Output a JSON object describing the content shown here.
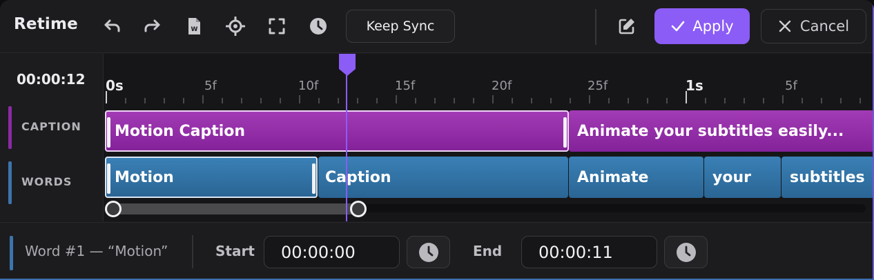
{
  "toolbar": {
    "title": "Retime",
    "icons": [
      "undo-icon",
      "redo-icon",
      "word-file-icon",
      "crosshair-icon",
      "fullscreen-icon",
      "clock-icon",
      "edit-icon"
    ],
    "keep_sync_label": "Keep Sync",
    "apply_label": "Apply",
    "cancel_label": "Cancel"
  },
  "timeline": {
    "current_time": "00:00:12",
    "ruler_labels": [
      "0s",
      "5f",
      "10f",
      "15f",
      "20f",
      "25f",
      "1s",
      "5f"
    ],
    "tracks": [
      {
        "label": "CAPTION",
        "color": "#8b2aa3",
        "clips": [
          "Motion Caption",
          "Animate your subtitles easily..."
        ]
      },
      {
        "label": "WORDS",
        "color": "#3c74ad",
        "clips": [
          "Motion",
          "Caption",
          "Animate",
          "your",
          "subtitles"
        ]
      }
    ],
    "playhead_color": "#8b5cf6"
  },
  "footer": {
    "selection": "Word #1 — “Motion”",
    "start_label": "Start",
    "start_value": "00:00:00",
    "end_label": "End",
    "end_value": "00:00:11"
  },
  "colors": {
    "accent": "#8b5cf6",
    "caption_clip": "#9a33b0",
    "word_clip": "#3478ad",
    "background": "#1a1a1c"
  }
}
